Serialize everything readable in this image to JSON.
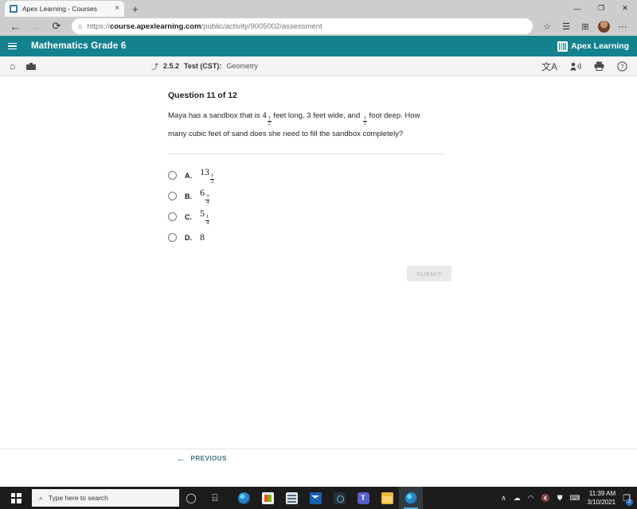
{
  "browser": {
    "tab": {
      "title": "Apex Learning - Courses",
      "favicon": "apex-favicon",
      "close": "×"
    },
    "new_tab": "+",
    "window_controls": {
      "minimize": "—",
      "maximize": "❐",
      "close": "✕"
    },
    "nav": {
      "back": "←",
      "forward": "→",
      "reload": "⟳"
    },
    "url": {
      "lock": "⌂",
      "scheme": "https://",
      "domain": "course.apexlearning.com",
      "path": "/public/activity/9005002/assessment"
    },
    "actions": {
      "favorite_add": "☆",
      "favorites": "☰",
      "collections": "⊞",
      "settings": "⋯"
    }
  },
  "app_header": {
    "menu_icon": "hamburger-menu",
    "course_title": "Mathematics Grade 6",
    "brand_text": "Apex Learning",
    "background": "#14818f"
  },
  "toolbar": {
    "home_icon": "⌂",
    "briefcase_icon": "▬",
    "breadcrumb": {
      "up_icon": "⤴",
      "number": "2.5.2",
      "label": "Test (CST):",
      "subject": "Geometry"
    },
    "right_icons": {
      "translate": "文A",
      "read_aloud": "☻",
      "print": "⎙",
      "help": "?"
    }
  },
  "question": {
    "heading": "Question 11 of 12",
    "text_part1": "Maya has a sandbox that is ",
    "length_whole": "4",
    "length_num": "1",
    "length_den": "2",
    "text_part2": " feet long, 3 feet wide, and ",
    "depth_num": "1",
    "depth_den": "2",
    "text_part3": " foot deep. How many cubic feet of sand does she need to fill the sandbox completely?"
  },
  "choices": [
    {
      "letter": "A.",
      "whole": "13",
      "num": "1",
      "den": "2",
      "selected": false
    },
    {
      "letter": "B.",
      "whole": "6",
      "num": "3",
      "den": "4",
      "selected": false
    },
    {
      "letter": "C.",
      "whole": "5",
      "num": "1",
      "den": "4",
      "selected": false
    },
    {
      "letter": "D.",
      "whole": "8",
      "num": "",
      "den": "",
      "selected": false
    }
  ],
  "submit": {
    "label": "SUBMIT",
    "enabled": false
  },
  "footer": {
    "previous_arrow": "←",
    "previous_label": "PREVIOUS"
  },
  "taskbar": {
    "start": "windows-logo",
    "search_placeholder": "Type here to search",
    "search_icon": "⌕",
    "cortana_icon": "◯",
    "taskview_icon": "⌸",
    "apps": [
      {
        "name": "edge",
        "label": "Microsoft Edge"
      },
      {
        "name": "store",
        "label": "Microsoft Store"
      },
      {
        "name": "calculator",
        "label": "Calculator"
      },
      {
        "name": "mail",
        "label": "Mail"
      },
      {
        "name": "camera",
        "label": "Camera"
      },
      {
        "name": "teams",
        "label": "Microsoft Teams"
      },
      {
        "name": "explorer",
        "label": "File Explorer"
      },
      {
        "name": "edge-active",
        "label": "Microsoft Edge"
      }
    ],
    "tray": {
      "chevron": "∧",
      "onedrive": "☁",
      "wifi": "◠",
      "volume": "🔇",
      "security": "⛊",
      "keyboard": "⌨"
    },
    "clock": {
      "time": "11:39 AM",
      "date": "3/10/2021"
    },
    "notifications": {
      "icon": "❐",
      "count": "2"
    }
  }
}
